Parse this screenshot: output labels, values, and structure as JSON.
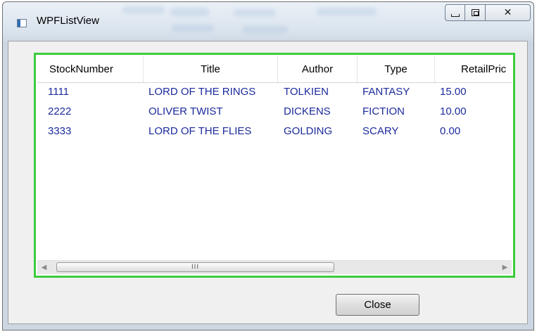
{
  "window": {
    "title": "WPFListView",
    "icon": "app-window-icon",
    "caption_buttons": [
      "minimize-icon",
      "maximize-icon",
      "close-icon"
    ]
  },
  "listview": {
    "columns": [
      "StockNumber",
      "Title",
      "Author",
      "Type",
      "RetailPric"
    ],
    "rows": [
      [
        "1111",
        "LORD OF THE RINGS",
        "TOLKIEN",
        "FANTASY",
        "15.00"
      ],
      [
        "2222",
        "OLIVER TWIST",
        "DICKENS",
        "FICTION",
        "10.00"
      ],
      [
        "3333",
        "LORD OF THE FLIES",
        "GOLDING",
        "SCARY",
        "0.00"
      ]
    ],
    "scrollbar_grip": "III"
  },
  "buttons": {
    "close_label": "Close"
  },
  "colors": {
    "focus_border": "#3ccc3c",
    "row_text": "#1c2a9c"
  }
}
